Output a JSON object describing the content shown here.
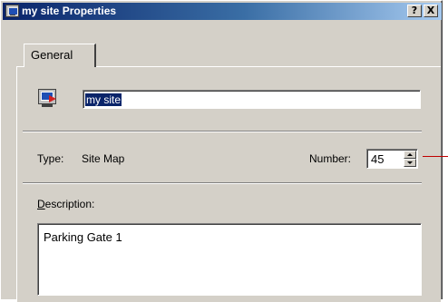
{
  "window": {
    "title": "my site Properties",
    "help_button": "?",
    "close_button": "X"
  },
  "tabs": [
    {
      "label": "General",
      "selected": true
    }
  ],
  "general": {
    "name_value": "my site",
    "type_label": "Type:",
    "type_value": "Site Map",
    "number_label": "Number:",
    "number_value": "45",
    "description_label_underlined": "D",
    "description_label_rest": "escription:",
    "description_value": "Parking Gate 1"
  },
  "colors": {
    "titlebar_start": "#0a246a",
    "titlebar_end": "#a6caf0",
    "dialog_face": "#d4d0c8",
    "selection": "#0a246a",
    "callout": "#c00000"
  },
  "icons": {
    "title": "site-map-icon",
    "object": "site-map-object-icon"
  }
}
